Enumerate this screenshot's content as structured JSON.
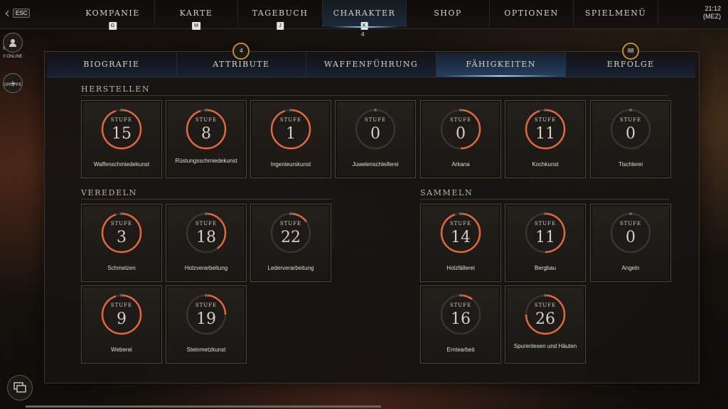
{
  "top_nav": {
    "esc_label": "ESC",
    "items": [
      {
        "label": "KOMPANIE",
        "key": "G"
      },
      {
        "label": "KARTE",
        "key": "M"
      },
      {
        "label": "TAGEBUCH",
        "key": "J"
      },
      {
        "label": "CHARAKTER",
        "key": "K",
        "sub": "4"
      },
      {
        "label": "SHOP",
        "key": ""
      },
      {
        "label": "OPTIONEN",
        "key": ""
      },
      {
        "label": "SPIELMENÜ",
        "key": ""
      }
    ],
    "clock": {
      "time": "21:12",
      "zone": "(MEZ)"
    }
  },
  "left_rail": {
    "online_count": "0",
    "online_label": "0 ONLINE",
    "group_label": "GRUPPE"
  },
  "tabs": [
    {
      "label": "BIOGRAFIE",
      "badge": ""
    },
    {
      "label": "ATTRIBUTE",
      "badge": "4"
    },
    {
      "label": "WAFFENFÜHRUNG",
      "badge": ""
    },
    {
      "label": "FÄHIGKEITEN",
      "badge": ""
    },
    {
      "label": "ERFOLGE",
      "badge": "88"
    }
  ],
  "stufe_label": "STUFE",
  "sections": {
    "herstellen": {
      "title": "HERSTELLEN",
      "skills": [
        {
          "name": "Waffenschmiedekunst",
          "level": "15",
          "progress": 0.95
        },
        {
          "name": "Rüstungsschmiedekunst",
          "level": "8",
          "progress": 0.95
        },
        {
          "name": "Ingenieurskunst",
          "level": "1",
          "progress": 0.95
        },
        {
          "name": "Juwelenschleiferei",
          "level": "0",
          "progress": 0
        },
        {
          "name": "Arkana",
          "level": "0",
          "progress": 0.5
        },
        {
          "name": "Kochkunst",
          "level": "11",
          "progress": 0.95
        },
        {
          "name": "Tischlerei",
          "level": "0",
          "progress": 0
        }
      ]
    },
    "veredeln": {
      "title": "VEREDELN",
      "skills": [
        {
          "name": "Schmelzen",
          "level": "3",
          "progress": 0.95
        },
        {
          "name": "Holzverarbeitung",
          "level": "18",
          "progress": 0.4
        },
        {
          "name": "Lederverarbeitung",
          "level": "22",
          "progress": 0.15
        },
        {
          "name": "Weberei",
          "level": "9",
          "progress": 0.95
        },
        {
          "name": "Steinmetzkunst",
          "level": "19",
          "progress": 0.25
        }
      ]
    },
    "sammeln": {
      "title": "SAMMELN",
      "skills": [
        {
          "name": "Holzfällerei",
          "level": "14",
          "progress": 0.95
        },
        {
          "name": "Bergbau",
          "level": "11",
          "progress": 0.5
        },
        {
          "name": "Angeln",
          "level": "0",
          "progress": 0
        },
        {
          "name": "Erntearbeit",
          "level": "16",
          "progress": 0.1
        },
        {
          "name": "Spurenlesen und Häuten",
          "level": "26",
          "progress": 0.75
        }
      ]
    }
  },
  "colors": {
    "ring_fill": "#e0683c",
    "ring_track": "#3a342e",
    "accent_blue": "#a8d9ff",
    "badge_border": "#c08a3a"
  }
}
